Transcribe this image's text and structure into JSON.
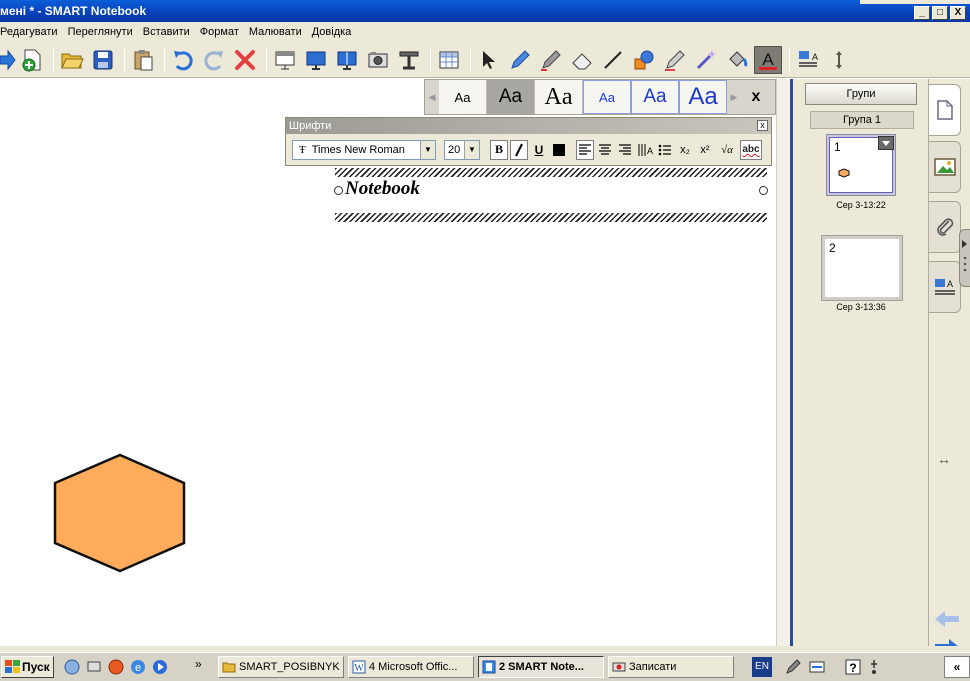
{
  "window": {
    "title": "мені * - SMART Notebook",
    "controls": [
      "_",
      "□",
      "X"
    ]
  },
  "menu": [
    "Редагувати",
    "Переглянути",
    "Вставити",
    "Формат",
    "Малювати",
    "Довідка"
  ],
  "font_presets": [
    "Aa",
    "Aa",
    "Aa",
    "Aa",
    "Aa",
    "Aa"
  ],
  "font_presets_close": "x",
  "fonts_toolbar": {
    "title": "Шрифти",
    "close": "x",
    "font_family": "Times New Roman",
    "font_size": "20",
    "bold": "B",
    "underline": "U",
    "subscript": "x₂",
    "superscript": "x²",
    "sqrt": "√α",
    "spell": "abc"
  },
  "text_object": {
    "text": "Notebook"
  },
  "right_panel": {
    "groups_button": "Групи",
    "group_label": "Група 1",
    "pages": [
      {
        "number": "1",
        "time": "Сер 3-13:22"
      },
      {
        "number": "2",
        "time": "Сер 3-13:36"
      }
    ]
  },
  "shape": {
    "type": "hexagon",
    "fill": "#ffab5c",
    "stroke": "#111111"
  },
  "colors": {
    "title_bar": "#0a4fd0",
    "chrome": "#ece9d8",
    "pen_active": "#7e7c74"
  },
  "taskbar": {
    "start": "Пуск",
    "tasks": [
      {
        "label": "SMART_POSIBNYK",
        "icon": "folder-icon"
      },
      {
        "label": "4 Microsoft Offic...",
        "icon": "word-icon"
      },
      {
        "label": "2 SMART Note...",
        "icon": "notebook-icon",
        "active": true
      },
      {
        "label": "Записати",
        "icon": "recorder-icon"
      }
    ],
    "language": "EN",
    "chevron": "»",
    "tray_chevron": "«"
  }
}
